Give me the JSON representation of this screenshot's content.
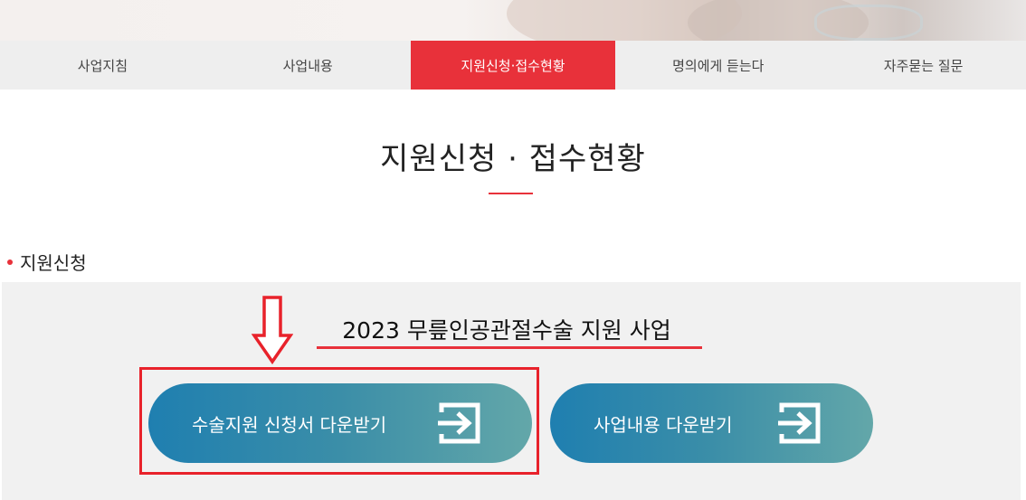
{
  "tabs": [
    {
      "label": "사업지침",
      "active": false
    },
    {
      "label": "사업내용",
      "active": false
    },
    {
      "label": "지원신청·접수현황",
      "active": true
    },
    {
      "label": "명의에게 듣는다",
      "active": false
    },
    {
      "label": "자주묻는 질문",
      "active": false
    }
  ],
  "page": {
    "title": "지원신청 · 접수현황"
  },
  "section": {
    "heading": "지원신청"
  },
  "banner": {
    "title": "2023 무릎인공관절수술 지원 사업"
  },
  "buttons": {
    "application_download": "수술지원 신청서 다운받기",
    "program_download": "사업내용 다운받기"
  },
  "colors": {
    "accent_red": "#e8313a",
    "button_gradient_start": "#1f7fb0",
    "button_gradient_end": "#63a7a9"
  },
  "icons": {
    "download_icon": "arrow-into-box-icon",
    "annotation_arrow": "down-arrow-icon"
  }
}
